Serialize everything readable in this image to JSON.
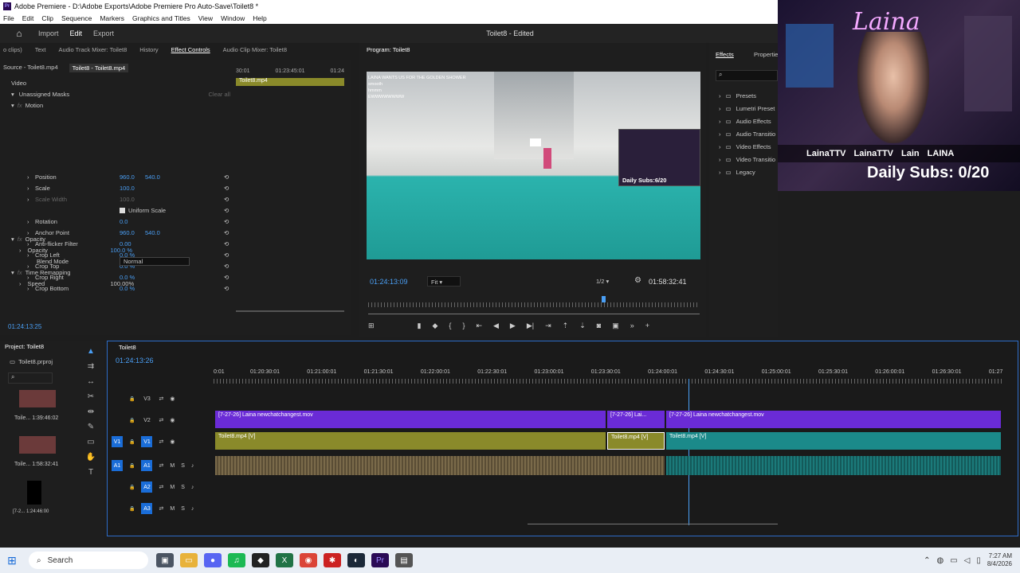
{
  "title_bar": {
    "app_badge": "Pr",
    "text": "Adobe Premiere - D:\\Adobe Exports\\Adobe Premiere Pro Auto-Save\\Toilet8 *"
  },
  "menu": [
    "File",
    "Edit",
    "Clip",
    "Sequence",
    "Markers",
    "Graphics and Titles",
    "View",
    "Window",
    "Help"
  ],
  "header": {
    "workspaces": [
      "Import",
      "Edit",
      "Export"
    ],
    "active_workspace": "Edit",
    "project_title": "Toilet8 - Edited"
  },
  "top_tabs": [
    "o clips)",
    "Text",
    "Audio Track Mixer: Toilet8",
    "History",
    "Effect Controls",
    "Audio Clip Mixer: Toilet8"
  ],
  "active_top_tab": "Effect Controls",
  "effect_controls": {
    "source_tab": "Source - Toilet8.mp4",
    "clip_tab": "Toilet8 - Toilet8.mp4",
    "mini_ruler": [
      "30:01",
      "01:23:45:01",
      "01:24"
    ],
    "mini_clip_label": "Toilet8.mp4",
    "section_video": "Video",
    "masks": "Unassigned Masks",
    "clear_all": "Clear all",
    "motion": "Motion",
    "rows": [
      {
        "label": "Position",
        "v1": "960.0",
        "v2": "540.0"
      },
      {
        "label": "Scale",
        "v1": "100.0",
        "v2": ""
      },
      {
        "label": "Scale Width",
        "v1": "100.0",
        "v2": ""
      },
      {
        "label": "Uniform Scale",
        "v1": "",
        "v2": ""
      },
      {
        "label": "Rotation",
        "v1": "0.0",
        "v2": ""
      },
      {
        "label": "Anchor Point",
        "v1": "960.0",
        "v2": "540.0"
      },
      {
        "label": "Anti-flicker Filter",
        "v1": "0.00",
        "v2": ""
      },
      {
        "label": "Crop Left",
        "v1": "0.0 %",
        "v2": ""
      },
      {
        "label": "Crop Top",
        "v1": "0.0 %",
        "v2": ""
      },
      {
        "label": "Crop Right",
        "v1": "0.0 %",
        "v2": ""
      },
      {
        "label": "Crop Bottom",
        "v1": "0.0 %",
        "v2": ""
      }
    ],
    "opacity_section": "Opacity",
    "opacity_label": "Opacity",
    "opacity_value": "100.0 %",
    "blend_label": "Blend Mode",
    "blend_value": "Normal",
    "time_remap": "Time Remapping",
    "speed_label": "Speed",
    "speed_value": "100.00%",
    "timecode": "01:24:13:25"
  },
  "program": {
    "tab": "Program: Toilet8",
    "timecode": "01:24:13:09",
    "fit": "Fit",
    "resolution": "1/2",
    "duration": "01:58:32:41",
    "chat_lines": [
      "LAINA WANTS US FOR THE GOLDEN SHOWER",
      "smooth",
      "hmmm",
      "EWWWWWWWW"
    ],
    "overlay_subs": "Daily Subs:6/20",
    "playhead_fraction": 0.71
  },
  "effects": {
    "tab": "Effects",
    "tab2": "Propertie",
    "items": [
      "Presets",
      "Lumetri Preset",
      "Audio Effects",
      "Audio Transitio",
      "Video Effects",
      "Video Transitio",
      "Legacy"
    ]
  },
  "webcam": {
    "name": "Laina",
    "handles": [
      "LainaTTV",
      "LainaTTV",
      "Lain"
    ],
    "brand": "LAINA",
    "daily_subs": "Daily Subs: 0/20"
  },
  "project": {
    "tab": "Project: Toilet8",
    "file": "Toilet8.prproj",
    "items": [
      {
        "name": "Toile...",
        "dur": "1:39:46:02"
      },
      {
        "name": "Toile...",
        "dur": "1:58:32:41"
      },
      {
        "name": "[7-2...",
        "dur": "1:24:46:00"
      }
    ]
  },
  "timeline": {
    "tab": "Toilet8",
    "timecode": "01:24:13:26",
    "ruler": [
      "0:01",
      "01:20:30:01",
      "01:21:00:01",
      "01:21:30:01",
      "01:22:00:01",
      "01:22:30:01",
      "01:23:00:01",
      "01:23:30:01",
      "01:24:00:01",
      "01:24:30:01",
      "01:25:00:01",
      "01:25:30:01",
      "01:26:00:01",
      "01:26:30:01",
      "01:27"
    ],
    "tracks": [
      "V3",
      "V2",
      "V1",
      "A1",
      "A2",
      "A3"
    ],
    "v2_clips": [
      "[7-27-26] Laina newchatchangest.mov",
      "[7-27-26] Lai...",
      "[7-27-26] Laina newchatchangest.mov"
    ],
    "v1_clips": [
      "Toilet8.mp4 [V]",
      "Toilet8.mp4 [V]",
      "Toilet8.mp4 [V]"
    ],
    "fx": "fx",
    "m": "M",
    "s": "S"
  },
  "taskbar": {
    "search": "Search",
    "time": "7:27 AM",
    "date": "8/4/2026"
  },
  "colors": {
    "accent_blue": "#4a9ff5",
    "v2_purple": "#6a2bd6",
    "v1_olive": "#8a8a2a",
    "v1_teal": "#1b8a8a",
    "audio": "#7a6a4a"
  }
}
